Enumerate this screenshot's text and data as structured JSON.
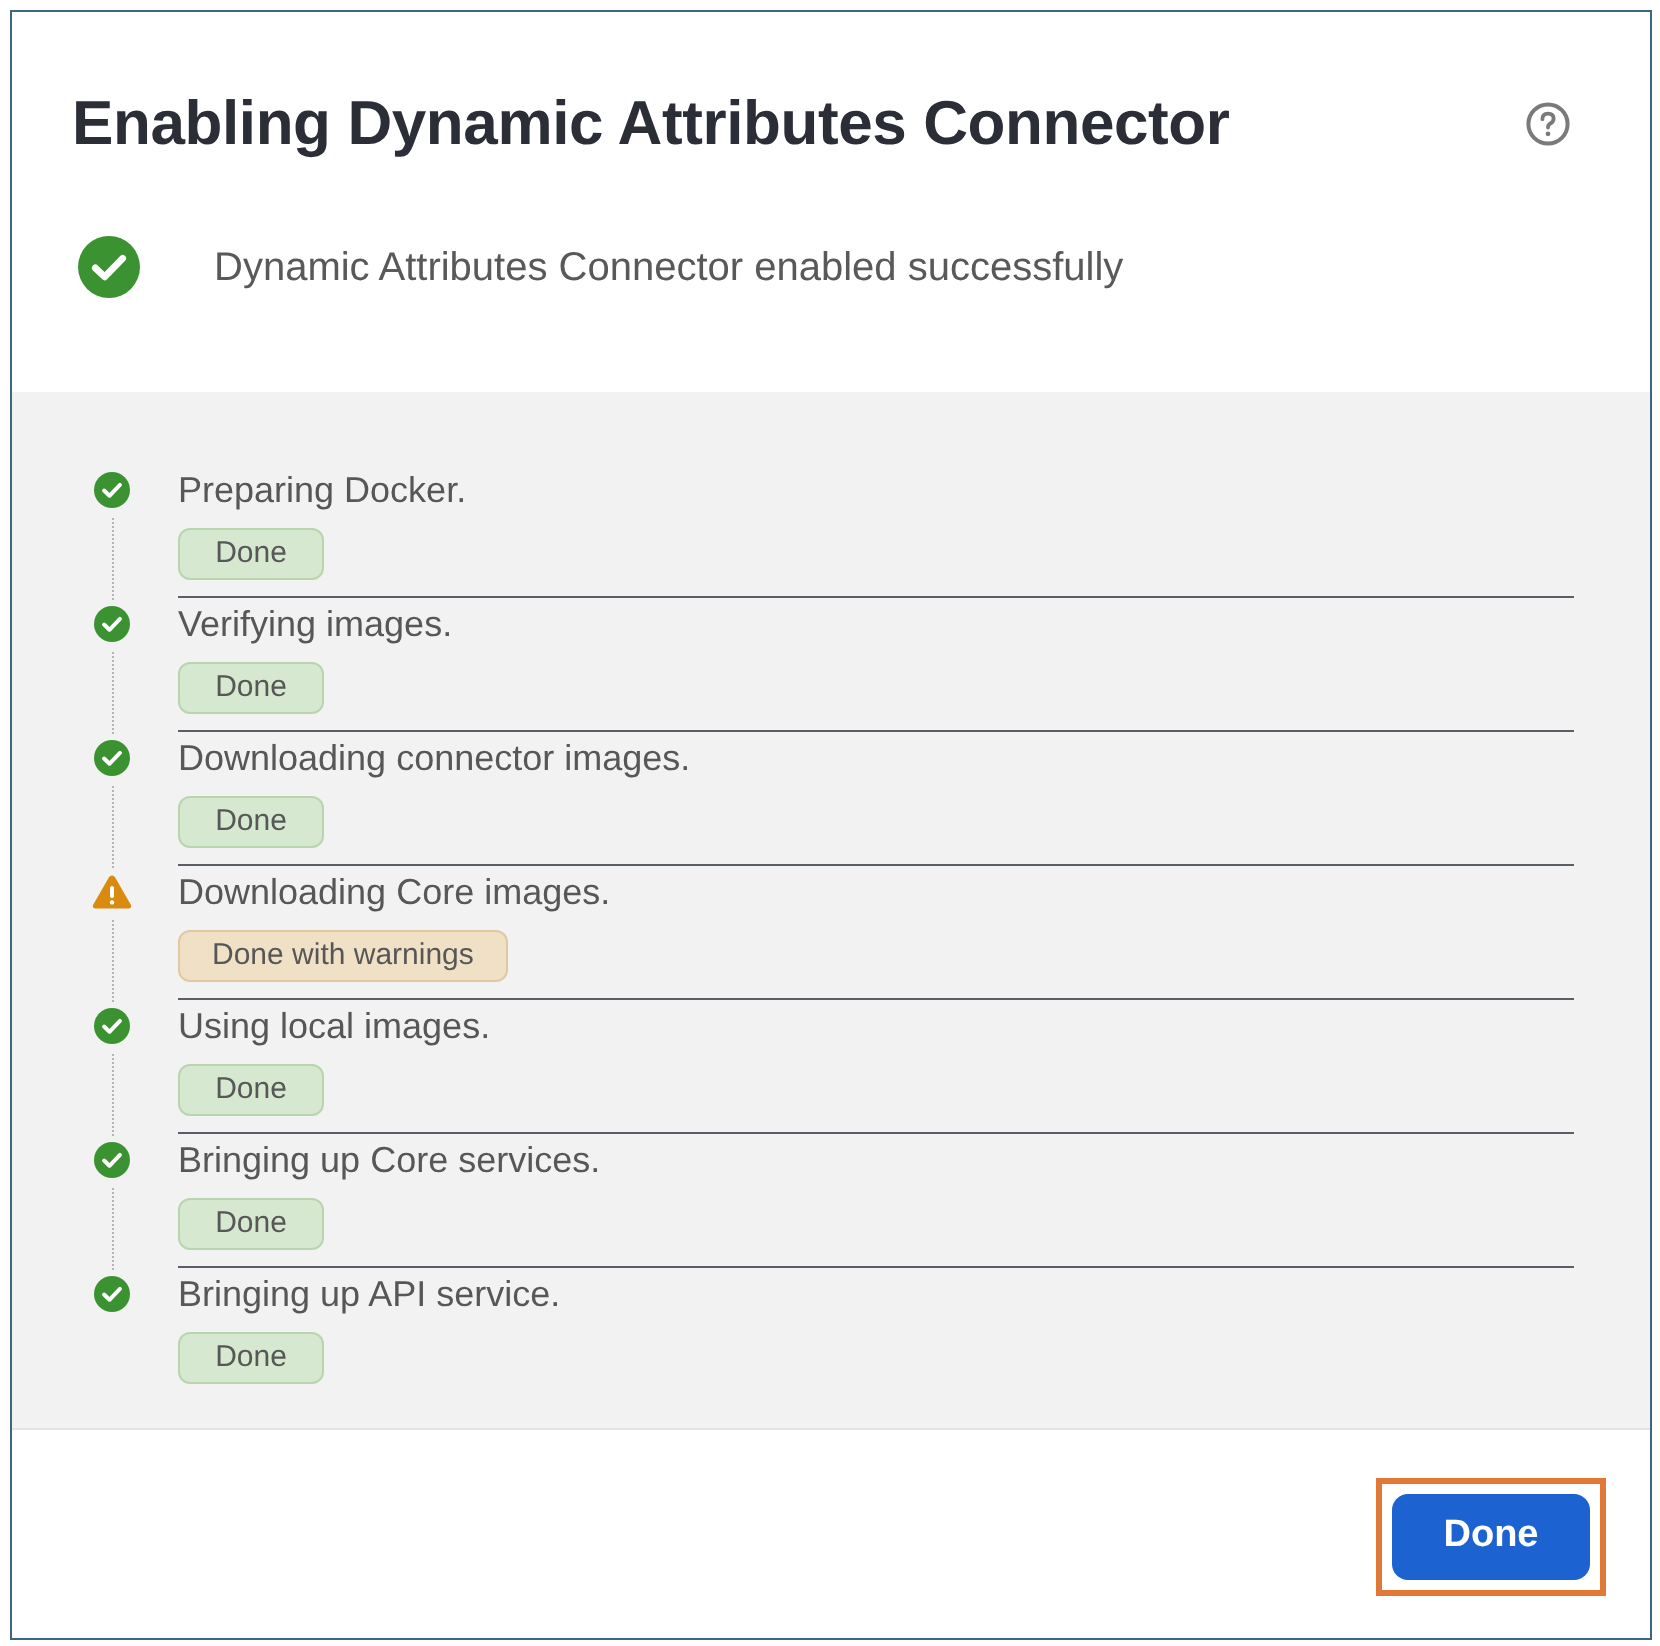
{
  "dialog": {
    "title": "Enabling Dynamic Attributes Connector",
    "result": {
      "kind": "success",
      "message": "Dynamic Attributes Connector enabled successfully"
    }
  },
  "steps": [
    {
      "label": "Preparing Docker.",
      "kind": "done",
      "badge": "Done"
    },
    {
      "label": "Verifying images.",
      "kind": "done",
      "badge": "Done"
    },
    {
      "label": "Downloading connector images.",
      "kind": "done",
      "badge": "Done"
    },
    {
      "label": "Downloading Core images.",
      "kind": "warning",
      "badge": "Done with warnings"
    },
    {
      "label": "Using local images.",
      "kind": "done",
      "badge": "Done"
    },
    {
      "label": "Bringing up Core services.",
      "kind": "done",
      "badge": "Done"
    },
    {
      "label": "Bringing up API service.",
      "kind": "done",
      "badge": "Done"
    }
  ],
  "footer": {
    "buttons": [
      {
        "label": "Done",
        "highlighted": true
      }
    ]
  }
}
